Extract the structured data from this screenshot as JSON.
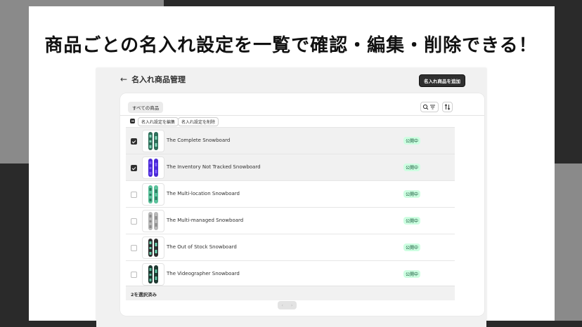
{
  "headline": "商品ごとの名入れ設定を一覧で確認・編集・削除できる！",
  "header": {
    "title": "名入れ商品管理",
    "add_button": "名入れ商品を追加"
  },
  "filters": {
    "tab_all": "すべての商品"
  },
  "bulk_actions": {
    "edit": "名入れ設定を編集",
    "delete": "名入れ設定を削除"
  },
  "products": [
    {
      "name": "The Complete Snowboard",
      "status": "公開中",
      "selected": true,
      "board_color": "#2f6e5a",
      "accent": "#7fd3b5"
    },
    {
      "name": "The Inventory Not Tracked Snowboard",
      "status": "公開中",
      "selected": true,
      "board_color": "#4b2ad6",
      "accent": "#7c5cff"
    },
    {
      "name": "The Multi-location Snowboard",
      "status": "公開中",
      "selected": false,
      "board_color": "#5cc29c",
      "accent": "#2a7a5e"
    },
    {
      "name": "The Multi-managed Snowboard",
      "status": "公開中",
      "selected": false,
      "board_color": "#b8b8b8",
      "accent": "#8a8a8a"
    },
    {
      "name": "The Out of Stock Snowboard",
      "status": "公開中",
      "selected": false,
      "board_color": "#2e2e2e",
      "accent": "#6ad2b0"
    },
    {
      "name": "The Videographer Snowboard",
      "status": "公開中",
      "selected": false,
      "board_color": "#1f3a32",
      "accent": "#5fbf9f"
    }
  ],
  "footer": {
    "selected_count": "2を選択済み"
  }
}
